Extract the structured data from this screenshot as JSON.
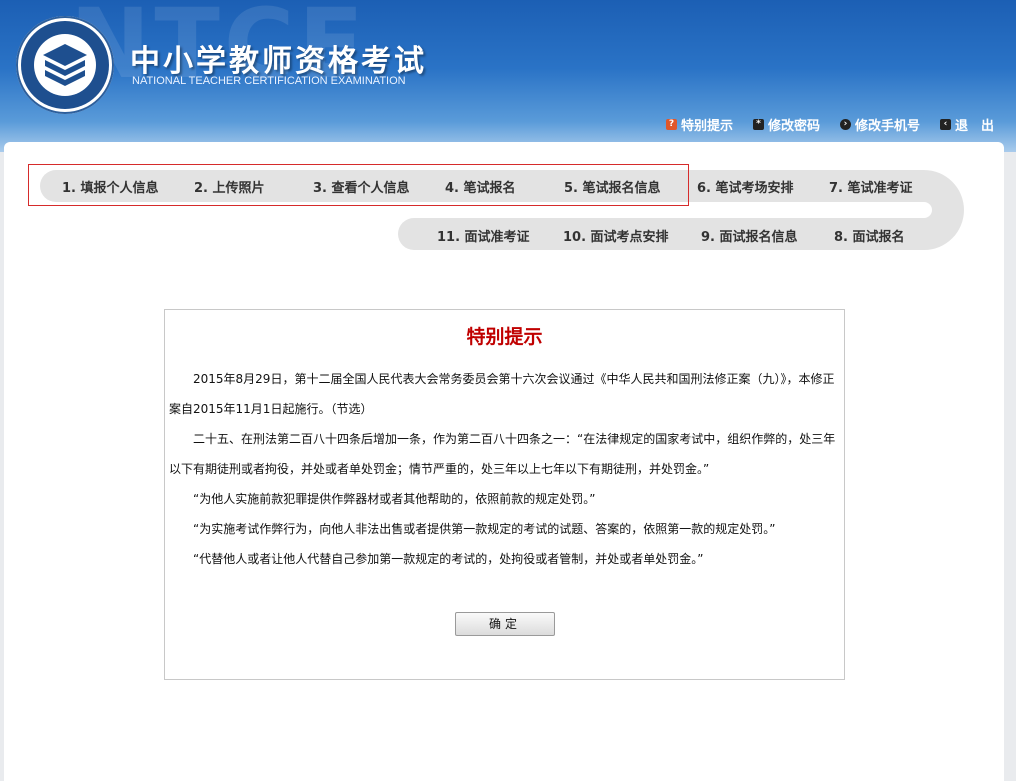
{
  "header": {
    "watermark": "NTCE",
    "title_cn": "中小学教师资格考试",
    "title_en": "NATIONAL TEACHER CERTIFICATION EXAMINATION",
    "links": [
      {
        "label": "特别提示",
        "icon": "help-icon"
      },
      {
        "label": "修改密码",
        "icon": "password-icon"
      },
      {
        "label": "修改手机号",
        "icon": "phone-icon"
      },
      {
        "label": "退　出",
        "icon": "exit-icon"
      }
    ]
  },
  "steps": {
    "row1": [
      "1. 填报个人信息",
      "2. 上传照片",
      "3. 查看个人信息",
      "4. 笔试报名",
      "5. 笔试报名信息",
      "6. 笔试考场安排",
      "7. 笔试准考证"
    ],
    "row2": [
      "11. 面试准考证",
      "10. 面试考点安排",
      "9. 面试报名信息",
      "8. 面试报名"
    ]
  },
  "notice": {
    "title": "特别提示",
    "paragraphs": [
      "2015年8月29日，第十二届全国人民代表大会常务委员会第十六次会议通过《中华人民共和国刑法修正案（九）》，本修正案自2015年11月1日起施行。（节选）",
      "二十五、在刑法第二百八十四条后增加一条，作为第二百八十四条之一：“在法律规定的国家考试中，组织作弊的，处三年以下有期徒刑或者拘役，并处或者单处罚金；情节严重的，处三年以上七年以下有期徒刑，并处罚金。”",
      "“为他人实施前款犯罪提供作弊器材或者其他帮助的，依照前款的规定处罚。”",
      "“为实施考试作弊行为，向他人非法出售或者提供第一款规定的考试的试题、答案的，依照第一款的规定处罚。”",
      "“代替他人或者让他人代替自己参加第一款规定的考试的，处拘役或者管制，并处或者单处罚金。”"
    ],
    "confirm_label": "确定"
  },
  "colors": {
    "header_blue": "#1c5fb4",
    "notice_title_red": "#c00000",
    "highlight_border": "#d62b2b",
    "step_track": "#e3e3e3"
  }
}
